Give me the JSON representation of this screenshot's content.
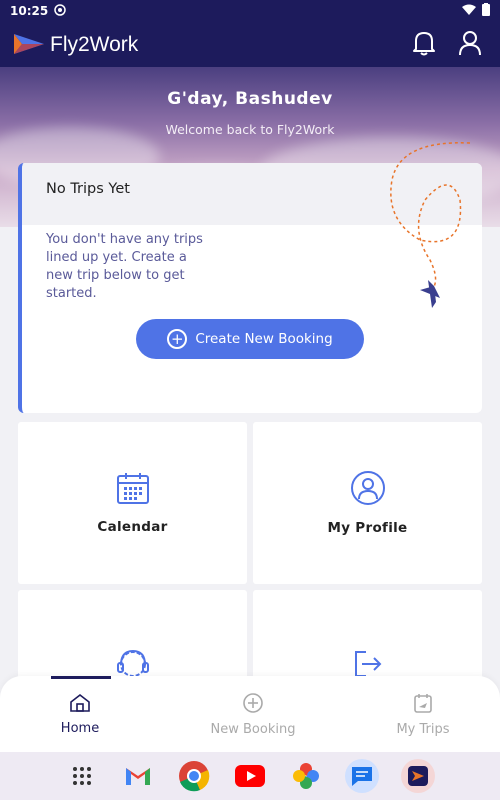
{
  "status_bar": {
    "time": "10:25"
  },
  "app": {
    "name": "Fly2Work"
  },
  "hero": {
    "greeting": "G'day, Bashudev",
    "welcome": "Welcome back to Fly2Work"
  },
  "trips_card": {
    "title": "No Trips Yet",
    "message": "You don't have any trips lined up yet. Create a new trip below to get started.",
    "button_label": "Create New Booking"
  },
  "tiles": [
    {
      "label": "Calendar",
      "icon": "calendar-icon"
    },
    {
      "label": "My Profile",
      "icon": "profile-icon"
    },
    {
      "label": "",
      "icon": "support-headset-icon"
    },
    {
      "label": "",
      "icon": "logout-icon"
    }
  ],
  "bottom_nav": [
    {
      "label": "Home",
      "icon": "home-icon",
      "active": true
    },
    {
      "label": "New Booking",
      "icon": "plus-circle-icon",
      "active": false
    },
    {
      "label": "My Trips",
      "icon": "calendar-plane-icon",
      "active": false
    }
  ],
  "colors": {
    "primary_dark": "#1d1b5c",
    "accent_blue": "#4f73e6",
    "orange_accent": "#e8742a"
  },
  "tray_apps": [
    "apps-grid-icon",
    "gmail-icon",
    "chrome-icon",
    "youtube-icon",
    "photos-icon",
    "messages-icon",
    "fly2work-app-icon"
  ]
}
